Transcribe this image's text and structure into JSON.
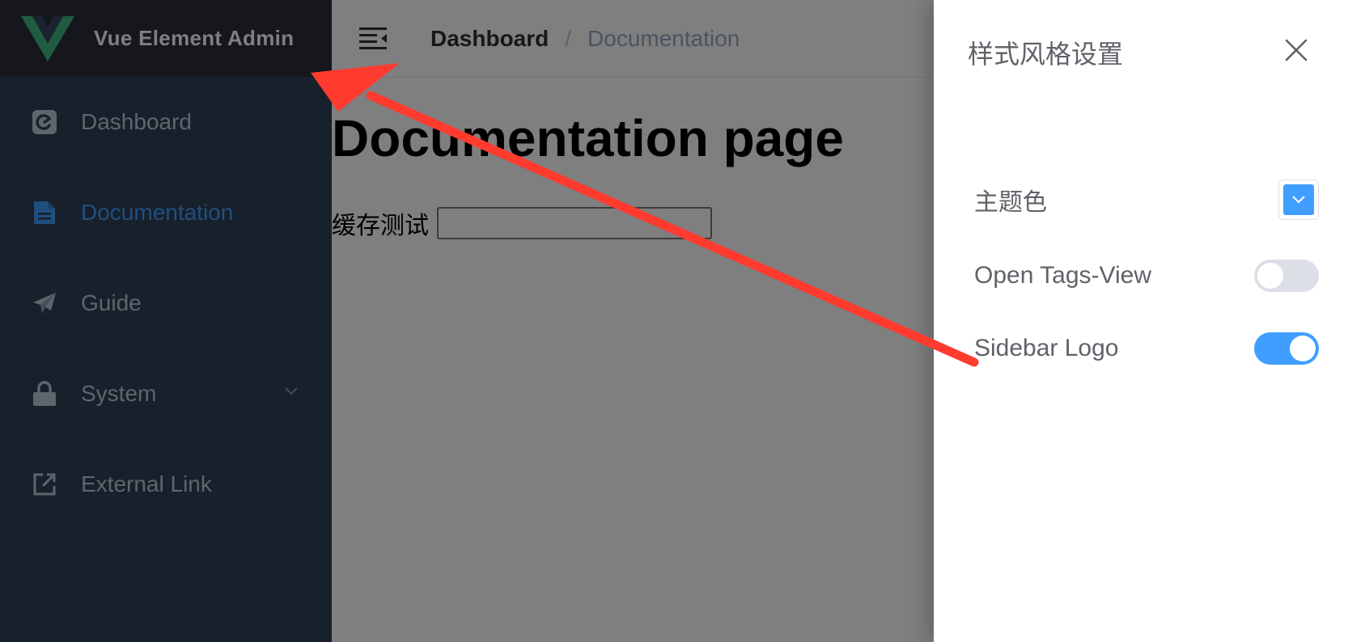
{
  "app": {
    "title": "Vue Element Admin",
    "logo_color": "#41b883"
  },
  "sidebar": {
    "items": [
      {
        "label": "Dashboard",
        "icon": "dashboard-icon",
        "active": false
      },
      {
        "label": "Documentation",
        "icon": "document-icon",
        "active": true
      },
      {
        "label": "Guide",
        "icon": "paper-plane-icon",
        "active": false
      },
      {
        "label": "System",
        "icon": "lock-icon",
        "active": false,
        "has_submenu": true
      },
      {
        "label": "External Link",
        "icon": "external-link-icon",
        "active": false
      }
    ]
  },
  "navbar": {
    "hamburger_icon": "hamburger-icon",
    "breadcrumb": {
      "first": "Dashboard",
      "separator": "/",
      "last": "Documentation"
    }
  },
  "main": {
    "title": "Documentation page",
    "cache_label": "缓存测试",
    "cache_value": ""
  },
  "drawer": {
    "title": "样式风格设置",
    "close_icon": "close-icon",
    "settings": {
      "theme_color": {
        "label": "主题色",
        "value": "#409eff"
      },
      "tags_view": {
        "label": "Open Tags-View",
        "enabled": false
      },
      "sidebar_logo": {
        "label": "Sidebar Logo",
        "enabled": true
      }
    }
  },
  "colors": {
    "sidebar_bg": "#304156",
    "logo_bg": "#2b2f3a",
    "menu_text": "#bfcbd9",
    "accent": "#409eff",
    "annotation_arrow": "#ff3b30"
  }
}
